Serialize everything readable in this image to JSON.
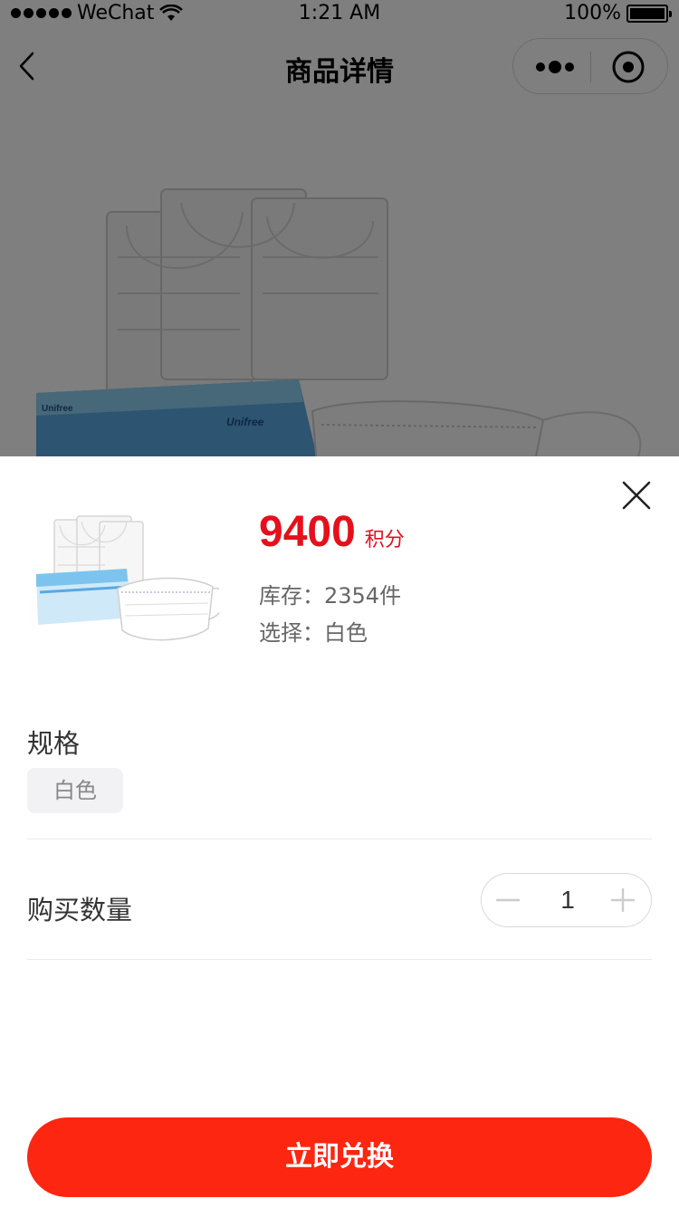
{
  "status_bar": {
    "carrier": "WeChat",
    "time": "1:21 AM",
    "battery": "100%"
  },
  "nav": {
    "title": "商品详情"
  },
  "product": {
    "brand_box_text": "Unifree",
    "price": "9400",
    "price_unit": "积分",
    "stock": "库存：2354件",
    "selected": "选择：白色"
  },
  "spec": {
    "title": "规格",
    "options": [
      "白色"
    ]
  },
  "quantity": {
    "label": "购买数量",
    "value": "1"
  },
  "action": {
    "redeem_label": "立即兑换"
  },
  "colors": {
    "accent_red": "#e5101c",
    "button_red": "#fd2611"
  }
}
